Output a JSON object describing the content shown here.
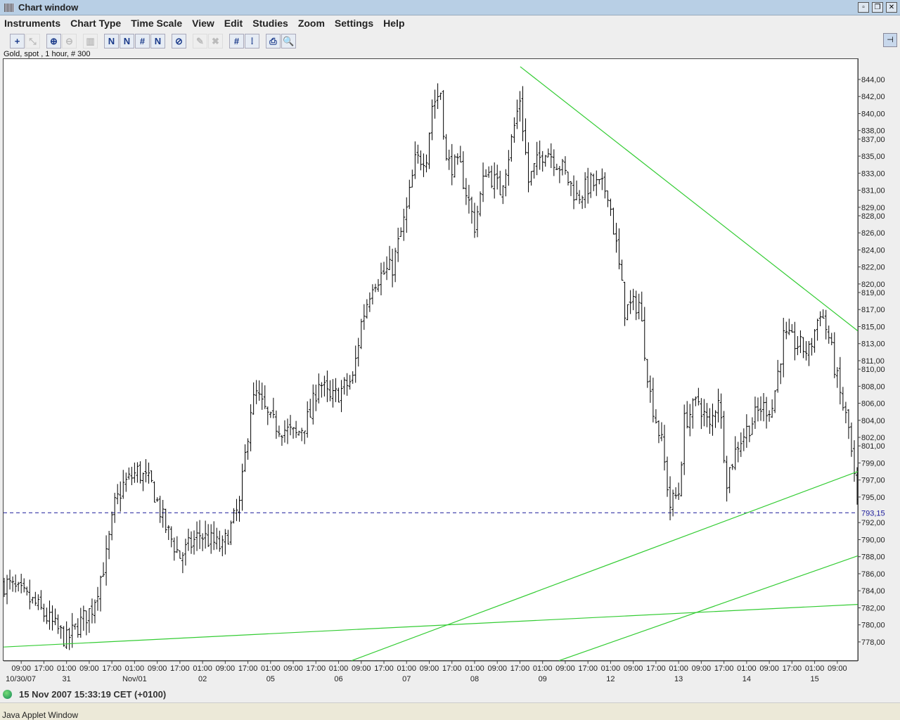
{
  "window": {
    "title": "Chart window",
    "controls": [
      "minimize",
      "restore",
      "close"
    ]
  },
  "menu": [
    "Instruments",
    "Chart Type",
    "Time Scale",
    "View",
    "Edit",
    "Studies",
    "Zoom",
    "Settings",
    "Help"
  ],
  "toolbar": [
    {
      "name": "crosshair-icon",
      "glyph": "+",
      "enabled": true
    },
    {
      "name": "pointer-icon",
      "glyph": "⤡",
      "enabled": false
    },
    {
      "gap": true
    },
    {
      "name": "zoom-in-icon",
      "glyph": "⊕",
      "enabled": true
    },
    {
      "name": "zoom-out-icon",
      "glyph": "⊖",
      "enabled": false
    },
    {
      "gap": true
    },
    {
      "name": "volume-icon",
      "glyph": "▥",
      "enabled": false
    },
    {
      "gap": true
    },
    {
      "name": "trendline-icon",
      "glyph": "N",
      "enabled": true
    },
    {
      "name": "channel-icon",
      "glyph": "N",
      "enabled": true
    },
    {
      "name": "parallel-icon",
      "glyph": "#",
      "enabled": true
    },
    {
      "name": "fan-icon",
      "glyph": "N",
      "enabled": true
    },
    {
      "gap": true
    },
    {
      "name": "delete-line-icon",
      "glyph": "⊘",
      "enabled": true
    },
    {
      "gap": true
    },
    {
      "name": "eraser-icon",
      "glyph": "✎",
      "enabled": false
    },
    {
      "name": "delete-all-icon",
      "glyph": "✖",
      "enabled": false
    },
    {
      "gap": true
    },
    {
      "name": "grid-icon",
      "glyph": "#",
      "enabled": true
    },
    {
      "name": "price-scale-icon",
      "glyph": "⁞",
      "enabled": true
    },
    {
      "gap": true
    },
    {
      "name": "print-icon",
      "glyph": "⎙",
      "enabled": true
    },
    {
      "name": "print-preview-icon",
      "glyph": "🔍",
      "enabled": true
    }
  ],
  "instrument_label": "Gold, spot , 1 hour, # 300",
  "status": {
    "timestamp": "15 Nov 2007 15:33:19  CET (+0100)"
  },
  "applet_label": "Java Applet Window",
  "chart_data": {
    "type": "ohlc",
    "title": "Gold, spot , 1 hour, # 300",
    "ylim": [
      775.5,
      846.5
    ],
    "y_ticks": [
      "844,00",
      "842,00",
      "840,00",
      "838,00",
      "837,00",
      "835,00",
      "833,00",
      "831,00",
      "829,00",
      "828,00",
      "826,00",
      "824,00",
      "822,00",
      "820,00",
      "819,00",
      "817,00",
      "815,00",
      "813,00",
      "811,00",
      "810,00",
      "808,00",
      "806,00",
      "804,00",
      "802,00",
      "801,00",
      "799,00",
      "797,00",
      "795,00",
      "792,00",
      "790,00",
      "788,00",
      "786,00",
      "784,00",
      "782,00",
      "780,00",
      "778,00"
    ],
    "current_price": {
      "value": 793.15,
      "label": "793,15",
      "color": "#1a1a9a"
    },
    "x_time_labels": [
      "09:00",
      "17:00",
      "01:00",
      "09:00",
      "17:00",
      "01:00",
      "09:00",
      "17:00",
      "01:00",
      "09:00",
      "17:00",
      "01:00",
      "09:00",
      "17:00",
      "01:00",
      "09:00",
      "17:00",
      "01:00",
      "09:00",
      "17:00",
      "01:00",
      "09:00",
      "17:00",
      "01:00",
      "09:00",
      "17:00",
      "01:00",
      "09:00",
      "17:00",
      "01:00",
      "09:00",
      "17:00",
      "01:00",
      "09:00",
      "17:00",
      "01:00",
      "09:00"
    ],
    "x_date_labels": [
      {
        "at": 0,
        "label": "10/30/07"
      },
      {
        "at": 2,
        "label": "31"
      },
      {
        "at": 5,
        "label": "Nov/01"
      },
      {
        "at": 8,
        "label": "02"
      },
      {
        "at": 11,
        "label": "05"
      },
      {
        "at": 14,
        "label": "06"
      },
      {
        "at": 17,
        "label": "07"
      },
      {
        "at": 20,
        "label": "08"
      },
      {
        "at": 23,
        "label": "09"
      },
      {
        "at": 26,
        "label": "12"
      },
      {
        "at": 29,
        "label": "13"
      },
      {
        "at": 32,
        "label": "14"
      },
      {
        "at": 35,
        "label": "15"
      }
    ],
    "first_label_bar": 6,
    "bars_per_label": 8,
    "bar_count": 302,
    "close_keypoints": [
      [
        1,
        784.8
      ],
      [
        11,
        782.4
      ],
      [
        22,
        778.2
      ],
      [
        31,
        782
      ],
      [
        36,
        788
      ],
      [
        39,
        794
      ],
      [
        42,
        796.4
      ],
      [
        47,
        798
      ],
      [
        52,
        796.4
      ],
      [
        57,
        791.4
      ],
      [
        62,
        788
      ],
      [
        69,
        790.6
      ],
      [
        77,
        789
      ],
      [
        83,
        794
      ],
      [
        87,
        805.5
      ],
      [
        89,
        807
      ],
      [
        94,
        803.8
      ],
      [
        103,
        802.2
      ],
      [
        108,
        804.6
      ],
      [
        111,
        808.8
      ],
      [
        115,
        806.3
      ],
      [
        123,
        808.8
      ],
      [
        126,
        815.4
      ],
      [
        130,
        820.3
      ],
      [
        137,
        822
      ],
      [
        142,
        828.6
      ],
      [
        145,
        834.3
      ],
      [
        149,
        835.2
      ],
      [
        151,
        841
      ],
      [
        154,
        842.6
      ],
      [
        156,
        834.3
      ],
      [
        161,
        833.5
      ],
      [
        166,
        826.9
      ],
      [
        170,
        833.5
      ],
      [
        175,
        831
      ],
      [
        178,
        835.2
      ],
      [
        182,
        841.8
      ],
      [
        185,
        832
      ],
      [
        187,
        833.5
      ],
      [
        191,
        836
      ],
      [
        197,
        833.5
      ],
      [
        202,
        830.2
      ],
      [
        207,
        831.8
      ],
      [
        213,
        831
      ],
      [
        216,
        824.4
      ],
      [
        219,
        817
      ],
      [
        224,
        817.8
      ],
      [
        228,
        807
      ],
      [
        232,
        801.3
      ],
      [
        235,
        794
      ],
      [
        238,
        795.6
      ],
      [
        240,
        803.8
      ],
      [
        245,
        806.3
      ],
      [
        249,
        803
      ],
      [
        252,
        807
      ],
      [
        255,
        797.2
      ],
      [
        259,
        801.3
      ],
      [
        267,
        805.5
      ],
      [
        271,
        805.5
      ],
      [
        275,
        813.7
      ],
      [
        280,
        812.9
      ],
      [
        284,
        812
      ],
      [
        288,
        817
      ],
      [
        291,
        813.7
      ],
      [
        295,
        807
      ],
      [
        298,
        803
      ],
      [
        301,
        794
      ]
    ],
    "trend_lines": [
      {
        "from": [
          182.1,
          845.5
        ],
        "to": [
          301.2,
          814.5
        ],
        "color": "#33cc33"
      },
      {
        "from": [
          122.6,
          775.8
        ],
        "to": [
          301.2,
          798.0
        ],
        "color": "#33cc33"
      },
      {
        "from": [
          195.8,
          775.8
        ],
        "to": [
          301.2,
          788.1
        ],
        "color": "#33cc33"
      },
      {
        "from": [
          -0.2,
          777.4
        ],
        "to": [
          301.2,
          782.4
        ],
        "color": "#33cc33"
      }
    ]
  }
}
